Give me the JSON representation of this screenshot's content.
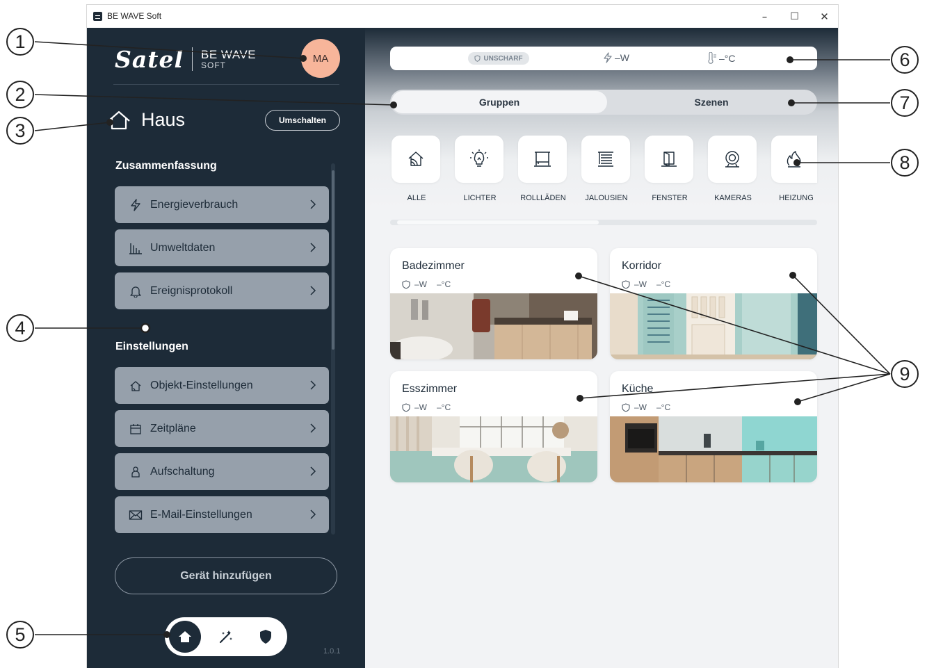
{
  "window": {
    "title": "BE WAVE Soft",
    "minimize": "–",
    "maximize": "☐",
    "close": "✕"
  },
  "sidebar": {
    "logo_satel": "Satel",
    "logo_bewave": "BE WAVE",
    "logo_soft": "SOFT",
    "avatar": "MA",
    "house_name": "Haus",
    "switch_button": "Umschalten",
    "summary_title": "Zusammenfassung",
    "summary_items": [
      {
        "label": "Energieverbrauch",
        "icon": "lightning-icon"
      },
      {
        "label": "Umweltdaten",
        "icon": "chart-icon"
      },
      {
        "label": "Ereignisprotokoll",
        "icon": "bell-icon"
      }
    ],
    "settings_title": "Einstellungen",
    "settings_items": [
      {
        "label": "Objekt-Einstellungen",
        "icon": "house-signal-icon"
      },
      {
        "label": "Zeitpläne",
        "icon": "calendar-icon"
      },
      {
        "label": "Aufschaltung",
        "icon": "user-icon"
      },
      {
        "label": "E-Mail-Einstellungen",
        "icon": "mail-icon"
      }
    ],
    "add_device": "Gerät hinzufügen",
    "version": "1.0.1",
    "nav": [
      "home-icon",
      "scenes-icon",
      "shield-icon"
    ]
  },
  "status": {
    "disarmed": "UNSCHARF",
    "power": "–W",
    "temperature": "–°C"
  },
  "tabs": {
    "groups": "Gruppen",
    "scenes": "Szenen"
  },
  "categories": [
    {
      "label": "ALLE",
      "icon": "house-signal-icon"
    },
    {
      "label": "LICHTER",
      "icon": "bulb-icon"
    },
    {
      "label": "ROLLLÄDEN",
      "icon": "roller-shutter-icon"
    },
    {
      "label": "JALOUSIEN",
      "icon": "blinds-icon"
    },
    {
      "label": "FENSTER",
      "icon": "window-icon"
    },
    {
      "label": "KAMERAS",
      "icon": "camera-icon"
    },
    {
      "label": "HEIZUNG",
      "icon": "heating-icon"
    }
  ],
  "rooms": [
    {
      "name": "Badezimmer",
      "power": "–W",
      "temp": "–°C"
    },
    {
      "name": "Korridor",
      "power": "–W",
      "temp": "–°C"
    },
    {
      "name": "Esszimmer",
      "power": "–W",
      "temp": "–°C"
    },
    {
      "name": "Küche",
      "power": "–W",
      "temp": "–°C"
    }
  ],
  "callouts": [
    "1",
    "2",
    "3",
    "4",
    "5",
    "6",
    "7",
    "8",
    "9"
  ],
  "colors": {
    "sidebar": "#1d2b38",
    "menu_item": "#96a0ab",
    "avatar": "#f7b59a",
    "main_bg": "#f2f3f5"
  }
}
